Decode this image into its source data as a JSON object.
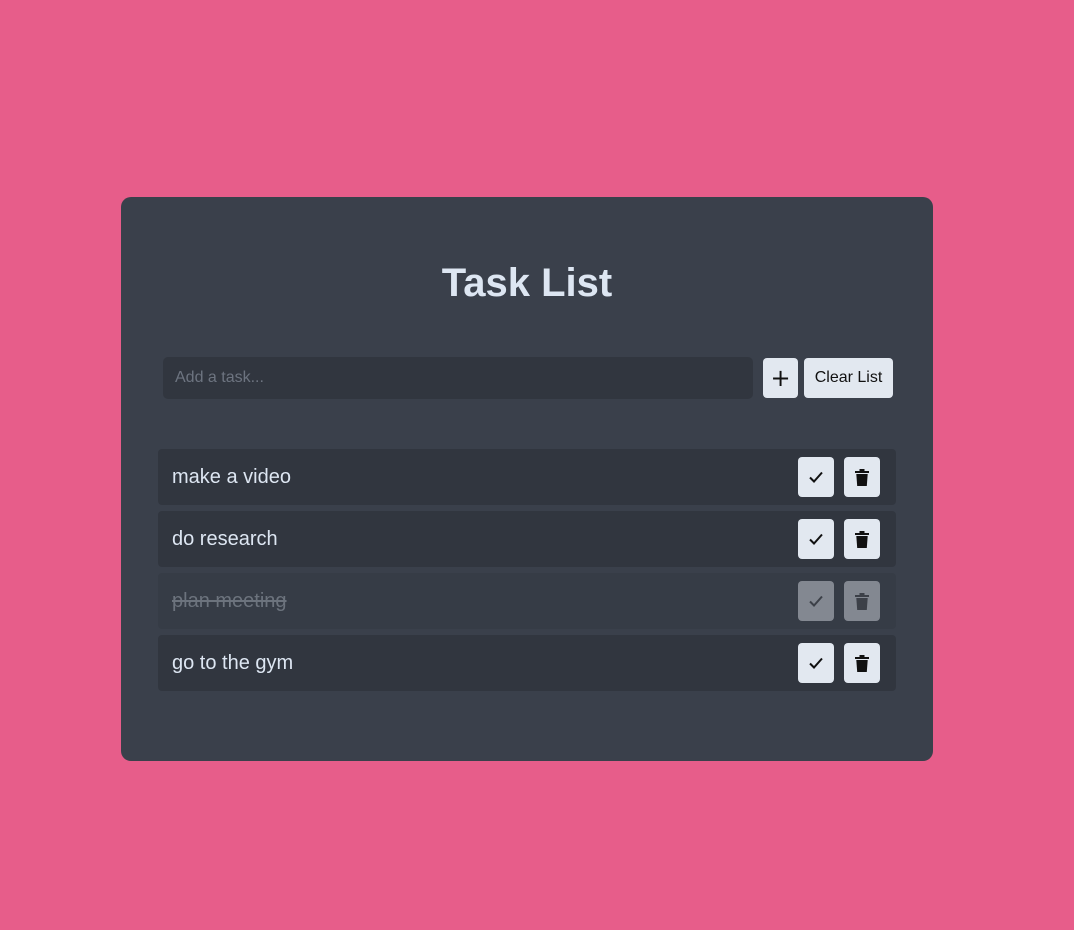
{
  "colors": {
    "page_background": "#e75d8a",
    "card_background": "#3a404b",
    "row_background": "#31363f",
    "button_background": "#e2e8f0",
    "title_color": "#dde6f2"
  },
  "app": {
    "title": "Task List"
  },
  "add_form": {
    "input_value": "",
    "input_placeholder": "Add a task...",
    "add_button_label": "+",
    "clear_button_label": "Clear List"
  },
  "tasks": [
    {
      "text": "make a video",
      "completed": false,
      "icons": [
        "check-icon",
        "trash-icon"
      ]
    },
    {
      "text": "do research",
      "completed": false,
      "icons": [
        "check-icon",
        "trash-icon"
      ]
    },
    {
      "text": "plan meeting",
      "completed": true,
      "icons": [
        "check-icon",
        "trash-icon"
      ]
    },
    {
      "text": "go to the gym",
      "completed": false,
      "icons": [
        "check-icon",
        "trash-icon"
      ]
    }
  ]
}
